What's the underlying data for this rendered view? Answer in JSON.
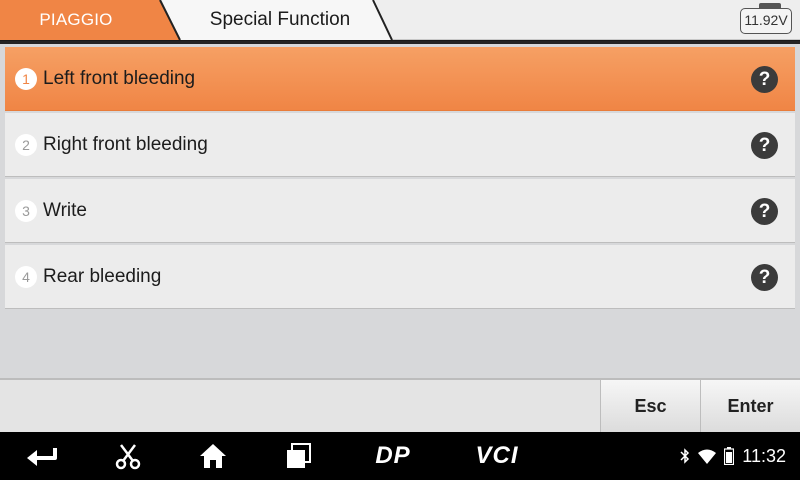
{
  "header": {
    "brand": "PIAGGIO",
    "title": "Special Function",
    "battery": "11.92V"
  },
  "menu": {
    "items": [
      {
        "number": "1",
        "label": "Left front bleeding",
        "help": "?"
      },
      {
        "number": "2",
        "label": "Right front bleeding",
        "help": "?"
      },
      {
        "number": "3",
        "label": "Write",
        "help": "?"
      },
      {
        "number": "4",
        "label": "Rear bleeding",
        "help": "?"
      }
    ],
    "selected_index": 0
  },
  "toolbar": {
    "esc_label": "Esc",
    "enter_label": "Enter"
  },
  "navbar": {
    "dp_label": "DP",
    "vci_label": "VCI",
    "time": "11:32",
    "icons": [
      "back-icon",
      "scissors-icon",
      "home-icon",
      "recent-apps-icon",
      "bluetooth-icon",
      "wifi-icon",
      "battery-icon"
    ]
  },
  "colors": {
    "accent": "#f08545",
    "header_bg": "#eeeeee",
    "list_bg": "#d7d8da",
    "nav_bg": "#000000"
  }
}
